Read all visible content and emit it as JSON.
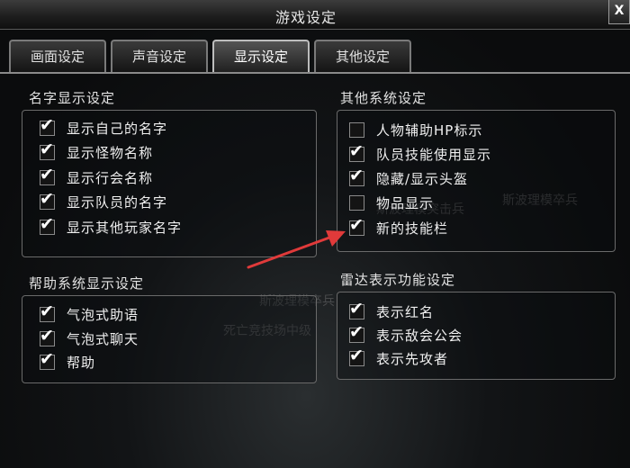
{
  "window": {
    "title": "游戏设定",
    "close_label": "X"
  },
  "tabs": [
    {
      "label": "画面设定",
      "active": false
    },
    {
      "label": "声音设定",
      "active": false
    },
    {
      "label": "显示设定",
      "active": true
    },
    {
      "label": "其他设定",
      "active": false
    }
  ],
  "name_display": {
    "title": "名字显示设定",
    "options": [
      {
        "label": "显示自己的名字",
        "checked": true
      },
      {
        "label": "显示怪物名称",
        "checked": true
      },
      {
        "label": "显示行会名称",
        "checked": true
      },
      {
        "label": "显示队员的名字",
        "checked": true
      },
      {
        "label": "显示其他玩家名字",
        "checked": true
      }
    ]
  },
  "other_system": {
    "title": "其他系统设定",
    "options": [
      {
        "label": "人物辅助HP标示",
        "checked": false
      },
      {
        "label": "队员技能使用显示",
        "checked": true
      },
      {
        "label": "隐藏/显示头盔",
        "checked": true
      },
      {
        "label": "物品显示",
        "checked": false
      },
      {
        "label": "新的技能栏",
        "checked": true
      }
    ]
  },
  "help_display": {
    "title": "帮助系统显示设定",
    "options": [
      {
        "label": "气泡式助语",
        "checked": true
      },
      {
        "label": "气泡式聊天",
        "checked": true
      },
      {
        "label": "帮助",
        "checked": true
      }
    ]
  },
  "radar": {
    "title": "雷达表示功能设定",
    "options": [
      {
        "label": "表示红名",
        "checked": true
      },
      {
        "label": "表示敌会公会",
        "checked": true
      },
      {
        "label": "表示先攻者",
        "checked": true
      }
    ]
  },
  "background_text": {
    "t1": "斯波理模突击兵",
    "t2": "斯波理模卒兵",
    "t3": "斯波理模卒兵",
    "t4": "死亡竞技场中级"
  },
  "annotation": {
    "arrow_color": "#e03a3a"
  }
}
